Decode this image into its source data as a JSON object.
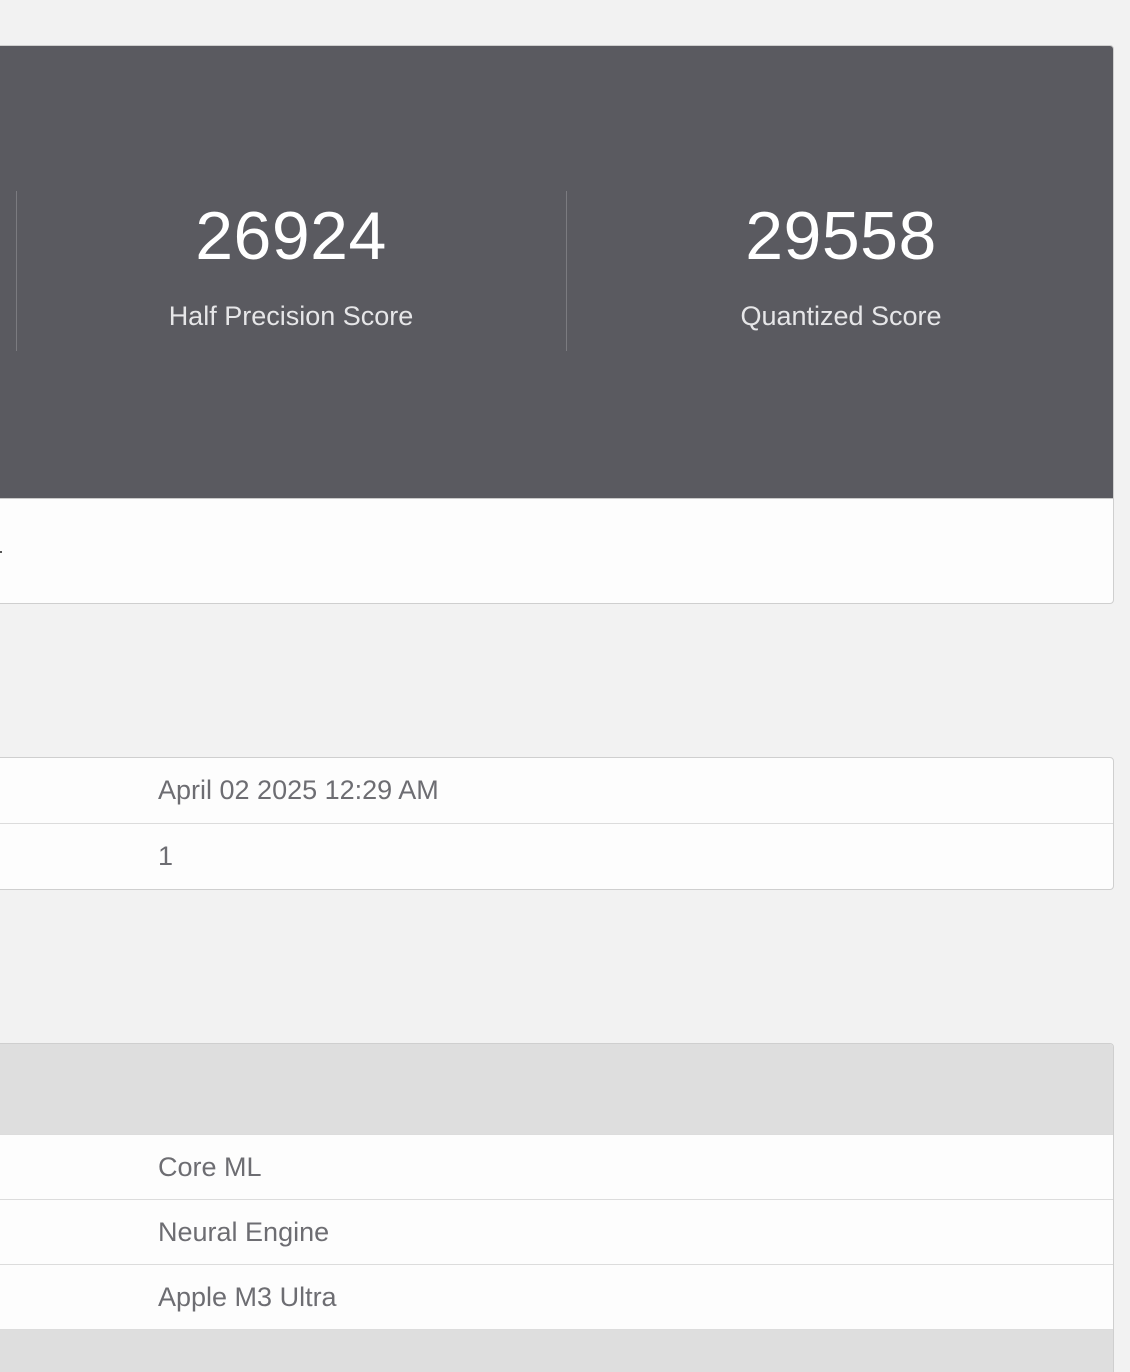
{
  "scores": {
    "half_precision": {
      "value": "26924",
      "label": "Half Precision Score"
    },
    "quantized": {
      "value": "29558",
      "label": "Quantized Score"
    }
  },
  "result_info": {
    "rows": [
      {
        "value": "April 02 2025 12:29 AM"
      },
      {
        "value": "1"
      }
    ]
  },
  "inference_info": {
    "rows": [
      {
        "value": "Core ML"
      },
      {
        "value": "Neural Engine"
      },
      {
        "value": "Apple M3 Ultra"
      }
    ]
  },
  "colors": {
    "page_bg": "#f2f2f2",
    "score_bg": "#5a5a60",
    "table_head_bg": "#dedede",
    "text_value": "#6d6d72"
  }
}
